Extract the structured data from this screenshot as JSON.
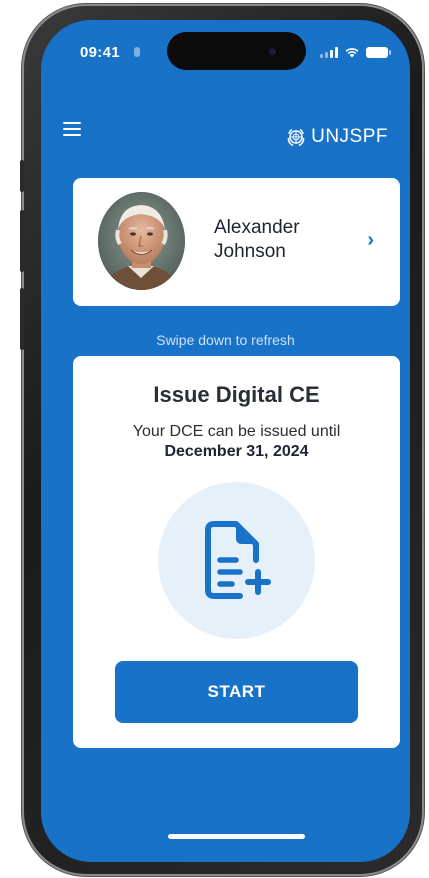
{
  "status_bar": {
    "time": "09:41"
  },
  "header": {
    "brand_text": "UNJSPF",
    "menu_icon": "hamburger-menu-icon",
    "brand_icon": "un-emblem-icon"
  },
  "profile": {
    "first_name": "Alexander",
    "last_name": "Johnson",
    "chevron": "›"
  },
  "refresh_hint": "Swipe down to refresh",
  "dce_card": {
    "title": "Issue Digital CE",
    "description": "Your DCE can be issued until",
    "date": "December 31, 2024",
    "icon": "document-add-icon",
    "start_label": "START"
  },
  "colors": {
    "brand_blue": "#1873c8",
    "icon_circle": "#e6f0f9",
    "card_bg": "#ffffff"
  }
}
